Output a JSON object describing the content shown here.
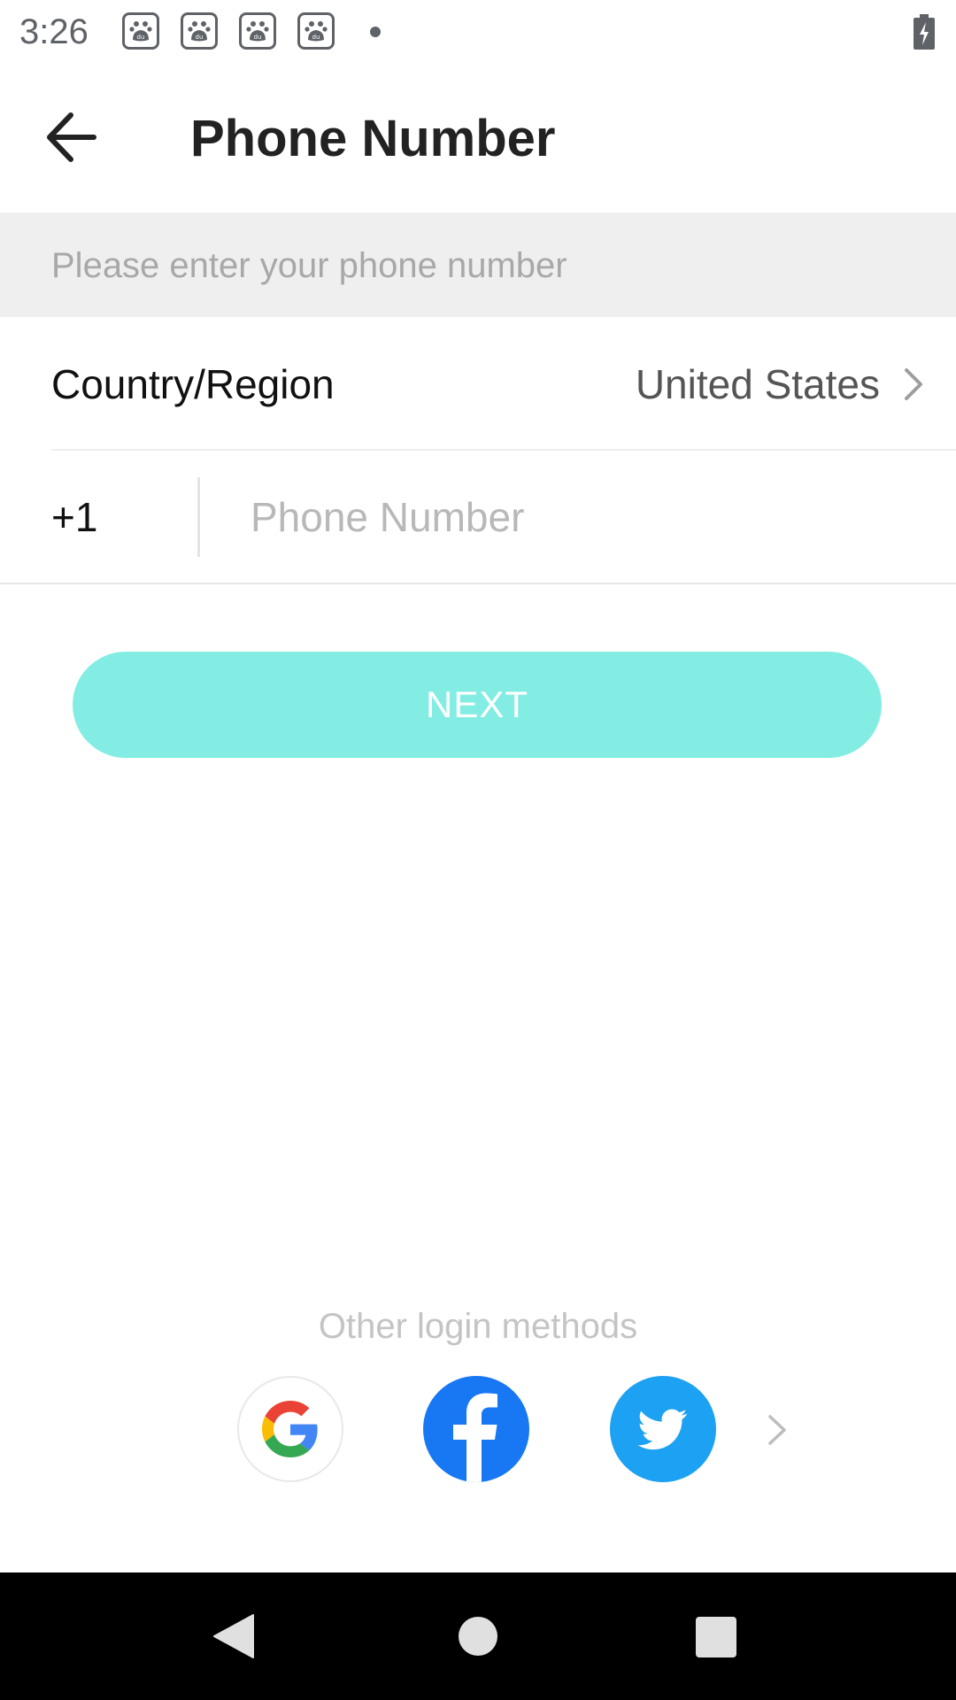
{
  "status_bar": {
    "time": "3:26",
    "notification_icons": [
      "baidu-icon",
      "baidu-icon",
      "baidu-icon",
      "baidu-icon"
    ],
    "battery_icon": "battery-charging-icon"
  },
  "header": {
    "back_icon": "arrow-left-icon",
    "title": "Phone Number"
  },
  "hint": {
    "text": "Please enter your phone number"
  },
  "country": {
    "label": "Country/Region",
    "value": "United States",
    "icon": "chevron-right-icon"
  },
  "phone": {
    "dial_code": "+1",
    "value": "",
    "placeholder": "Phone Number"
  },
  "actions": {
    "next_label": "NEXT",
    "next_color": "#84ede3"
  },
  "other_login": {
    "label": "Other login methods",
    "methods": [
      {
        "name": "google",
        "icon": "google-icon"
      },
      {
        "name": "facebook",
        "icon": "facebook-icon",
        "color": "#1877f2"
      },
      {
        "name": "twitter",
        "icon": "twitter-icon",
        "color": "#1da1f2"
      }
    ],
    "more_icon": "chevron-right-icon"
  },
  "nav_bar": {
    "buttons": [
      "back-icon",
      "home-icon",
      "recents-icon"
    ]
  }
}
